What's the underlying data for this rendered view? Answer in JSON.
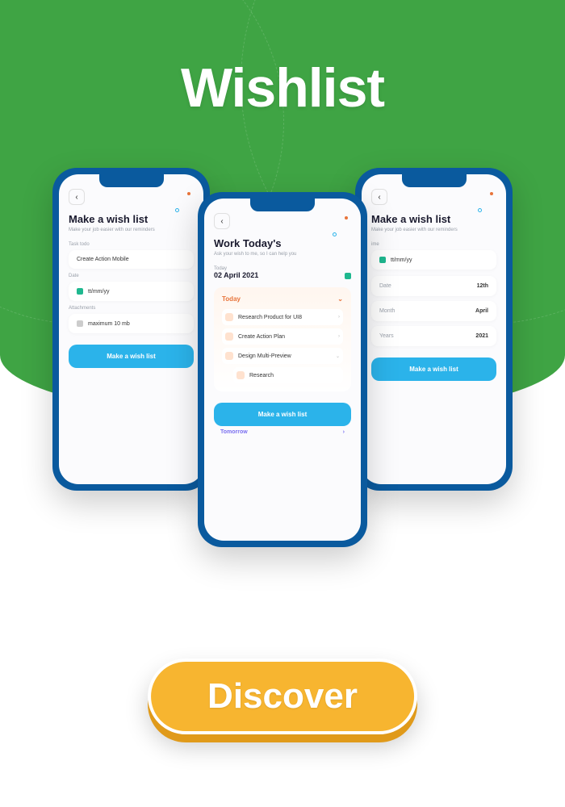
{
  "hero": {
    "title": "Wishlist"
  },
  "discover": {
    "label": "Discover"
  },
  "phone_left": {
    "title": "Make a wish list",
    "subtitle": "Make your job easier with our reminders",
    "task_label": "Task todo",
    "task_value": "Create Action Mobile",
    "date_label": "Date",
    "date_value": "tt/mm/yy",
    "attach_label": "Attachments",
    "attach_value": "maximum 10 mb",
    "cta": "Make a wish list"
  },
  "phone_center": {
    "title": "Work Today's",
    "subtitle": "Ask your wish to me, so I can help you",
    "today_label": "Today",
    "date_value": "02 April 2021",
    "section": "Today",
    "tasks": [
      "Research Product for UI8",
      "Create Action Plan",
      "Design Multi-Preview"
    ],
    "subtask": "Research",
    "cta": "Make a wish list",
    "tomorrow": "Tomorrow"
  },
  "phone_right": {
    "title": "Make a wish list",
    "subtitle": "Make your job easier with our reminders",
    "time_label": "ime",
    "time_value": "tt/mm/yy",
    "rows": [
      {
        "label": "Date",
        "value": "12th"
      },
      {
        "label": "Month",
        "value": "April"
      },
      {
        "label": "Years",
        "value": "2021"
      }
    ],
    "cta": "Make a wish list"
  }
}
